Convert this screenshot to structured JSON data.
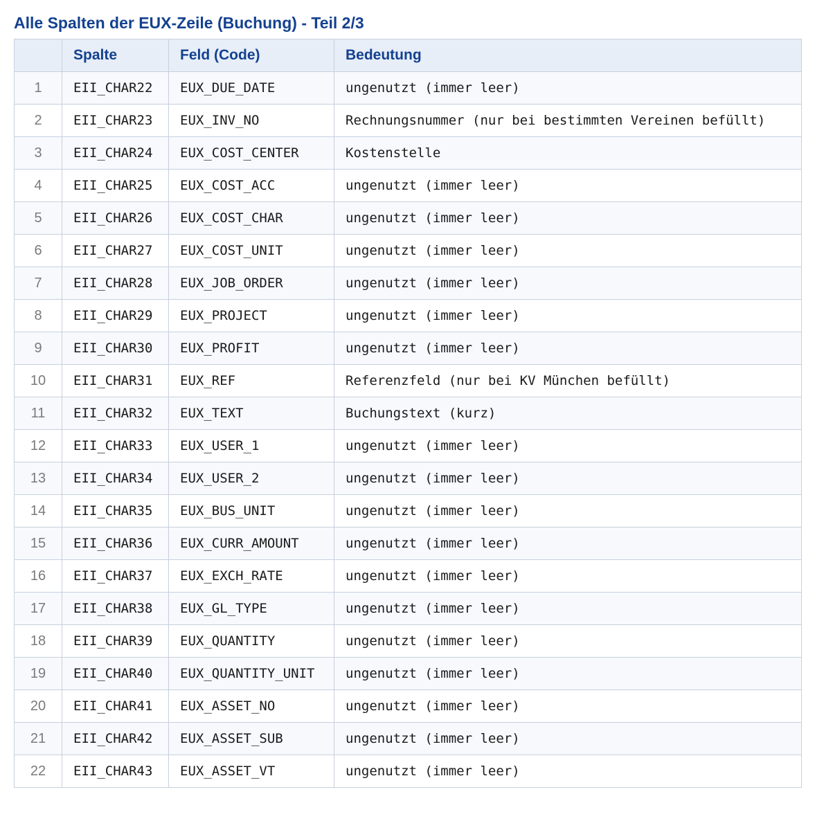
{
  "title": "Alle Spalten der EUX-Zeile (Buchung) - Teil 2/3",
  "columns": [
    "",
    "Spalte",
    "Feld (Code)",
    "Bedeutung"
  ],
  "rows": [
    {
      "num": "1",
      "spalte": "EII_CHAR22",
      "feld": "EUX_DUE_DATE",
      "bedeutung": "ungenutzt (immer leer)"
    },
    {
      "num": "2",
      "spalte": "EII_CHAR23",
      "feld": "EUX_INV_NO",
      "bedeutung": "Rechnungsnummer (nur bei bestimmten Vereinen befüllt)"
    },
    {
      "num": "3",
      "spalte": "EII_CHAR24",
      "feld": "EUX_COST_CENTER",
      "bedeutung": "Kostenstelle"
    },
    {
      "num": "4",
      "spalte": "EII_CHAR25",
      "feld": "EUX_COST_ACC",
      "bedeutung": "ungenutzt (immer leer)"
    },
    {
      "num": "5",
      "spalte": "EII_CHAR26",
      "feld": "EUX_COST_CHAR",
      "bedeutung": "ungenutzt (immer leer)"
    },
    {
      "num": "6",
      "spalte": "EII_CHAR27",
      "feld": "EUX_COST_UNIT",
      "bedeutung": "ungenutzt (immer leer)"
    },
    {
      "num": "7",
      "spalte": "EII_CHAR28",
      "feld": "EUX_JOB_ORDER",
      "bedeutung": "ungenutzt (immer leer)"
    },
    {
      "num": "8",
      "spalte": "EII_CHAR29",
      "feld": "EUX_PROJECT",
      "bedeutung": "ungenutzt (immer leer)"
    },
    {
      "num": "9",
      "spalte": "EII_CHAR30",
      "feld": "EUX_PROFIT",
      "bedeutung": "ungenutzt (immer leer)"
    },
    {
      "num": "10",
      "spalte": "EII_CHAR31",
      "feld": "EUX_REF",
      "bedeutung": "Referenzfeld (nur bei KV München befüllt)"
    },
    {
      "num": "11",
      "spalte": "EII_CHAR32",
      "feld": "EUX_TEXT",
      "bedeutung": "Buchungstext (kurz)"
    },
    {
      "num": "12",
      "spalte": "EII_CHAR33",
      "feld": "EUX_USER_1",
      "bedeutung": "ungenutzt (immer leer)"
    },
    {
      "num": "13",
      "spalte": "EII_CHAR34",
      "feld": "EUX_USER_2",
      "bedeutung": "ungenutzt (immer leer)"
    },
    {
      "num": "14",
      "spalte": "EII_CHAR35",
      "feld": "EUX_BUS_UNIT",
      "bedeutung": "ungenutzt (immer leer)"
    },
    {
      "num": "15",
      "spalte": "EII_CHAR36",
      "feld": "EUX_CURR_AMOUNT",
      "bedeutung": "ungenutzt (immer leer)"
    },
    {
      "num": "16",
      "spalte": "EII_CHAR37",
      "feld": "EUX_EXCH_RATE",
      "bedeutung": "ungenutzt (immer leer)"
    },
    {
      "num": "17",
      "spalte": "EII_CHAR38",
      "feld": "EUX_GL_TYPE",
      "bedeutung": "ungenutzt (immer leer)"
    },
    {
      "num": "18",
      "spalte": "EII_CHAR39",
      "feld": "EUX_QUANTITY",
      "bedeutung": "ungenutzt (immer leer)"
    },
    {
      "num": "19",
      "spalte": "EII_CHAR40",
      "feld": "EUX_QUANTITY_UNIT",
      "bedeutung": "ungenutzt (immer leer)"
    },
    {
      "num": "20",
      "spalte": "EII_CHAR41",
      "feld": "EUX_ASSET_NO",
      "bedeutung": "ungenutzt (immer leer)"
    },
    {
      "num": "21",
      "spalte": "EII_CHAR42",
      "feld": "EUX_ASSET_SUB",
      "bedeutung": "ungenutzt (immer leer)"
    },
    {
      "num": "22",
      "spalte": "EII_CHAR43",
      "feld": "EUX_ASSET_VT",
      "bedeutung": "ungenutzt (immer leer)"
    }
  ]
}
